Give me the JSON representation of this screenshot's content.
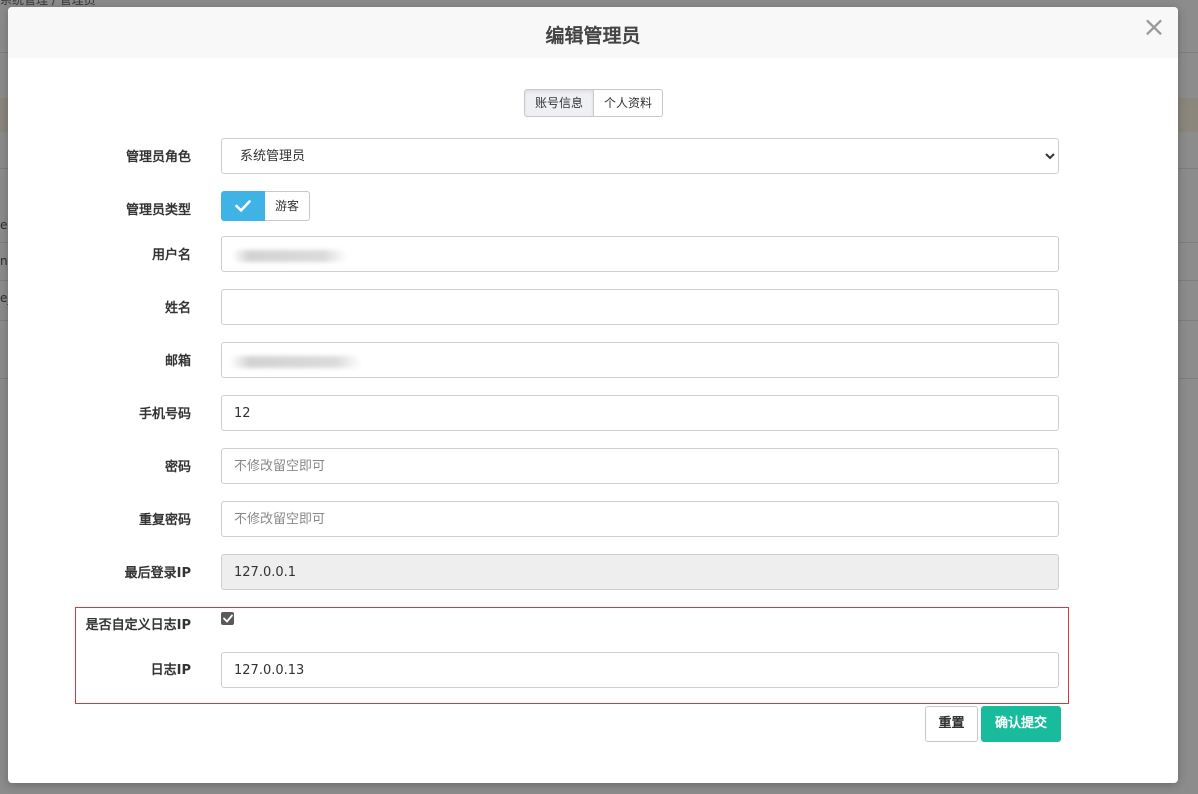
{
  "background": {
    "breadcrumb": "系统管理 / 管理员",
    "fragments": [
      "e",
      "n",
      "e_"
    ]
  },
  "modal": {
    "title": "编辑管理员",
    "close_label": "×",
    "tabs": [
      {
        "label": "账号信息",
        "active": true
      },
      {
        "label": "个人资料",
        "active": false
      }
    ]
  },
  "form": {
    "role": {
      "label": "管理员角色",
      "value": "系统管理员",
      "options": [
        "系统管理员"
      ]
    },
    "type": {
      "label": "管理员类型",
      "toggle_off_label": "游客",
      "checked": true
    },
    "username": {
      "label": "用户名",
      "value": ""
    },
    "name": {
      "label": "姓名",
      "value": ""
    },
    "email": {
      "label": "邮箱",
      "value": ""
    },
    "phone": {
      "label": "手机号码",
      "value": "12"
    },
    "password": {
      "label": "密码",
      "placeholder": "不修改留空即可"
    },
    "password_repeat": {
      "label": "重复密码",
      "placeholder": "不修改留空即可"
    },
    "last_login_ip": {
      "label": "最后登录IP",
      "value": "127.0.0.1"
    },
    "custom_log_ip": {
      "label": "是否自定义日志IP",
      "checked": true
    },
    "log_ip": {
      "label": "日志IP",
      "value": "127.0.0.13"
    }
  },
  "buttons": {
    "reset": "重置",
    "submit": "确认提交"
  },
  "colors": {
    "accent_blue": "#3fb3e6",
    "submit_green": "#18bc9c",
    "highlight_red": "#d9363e"
  }
}
